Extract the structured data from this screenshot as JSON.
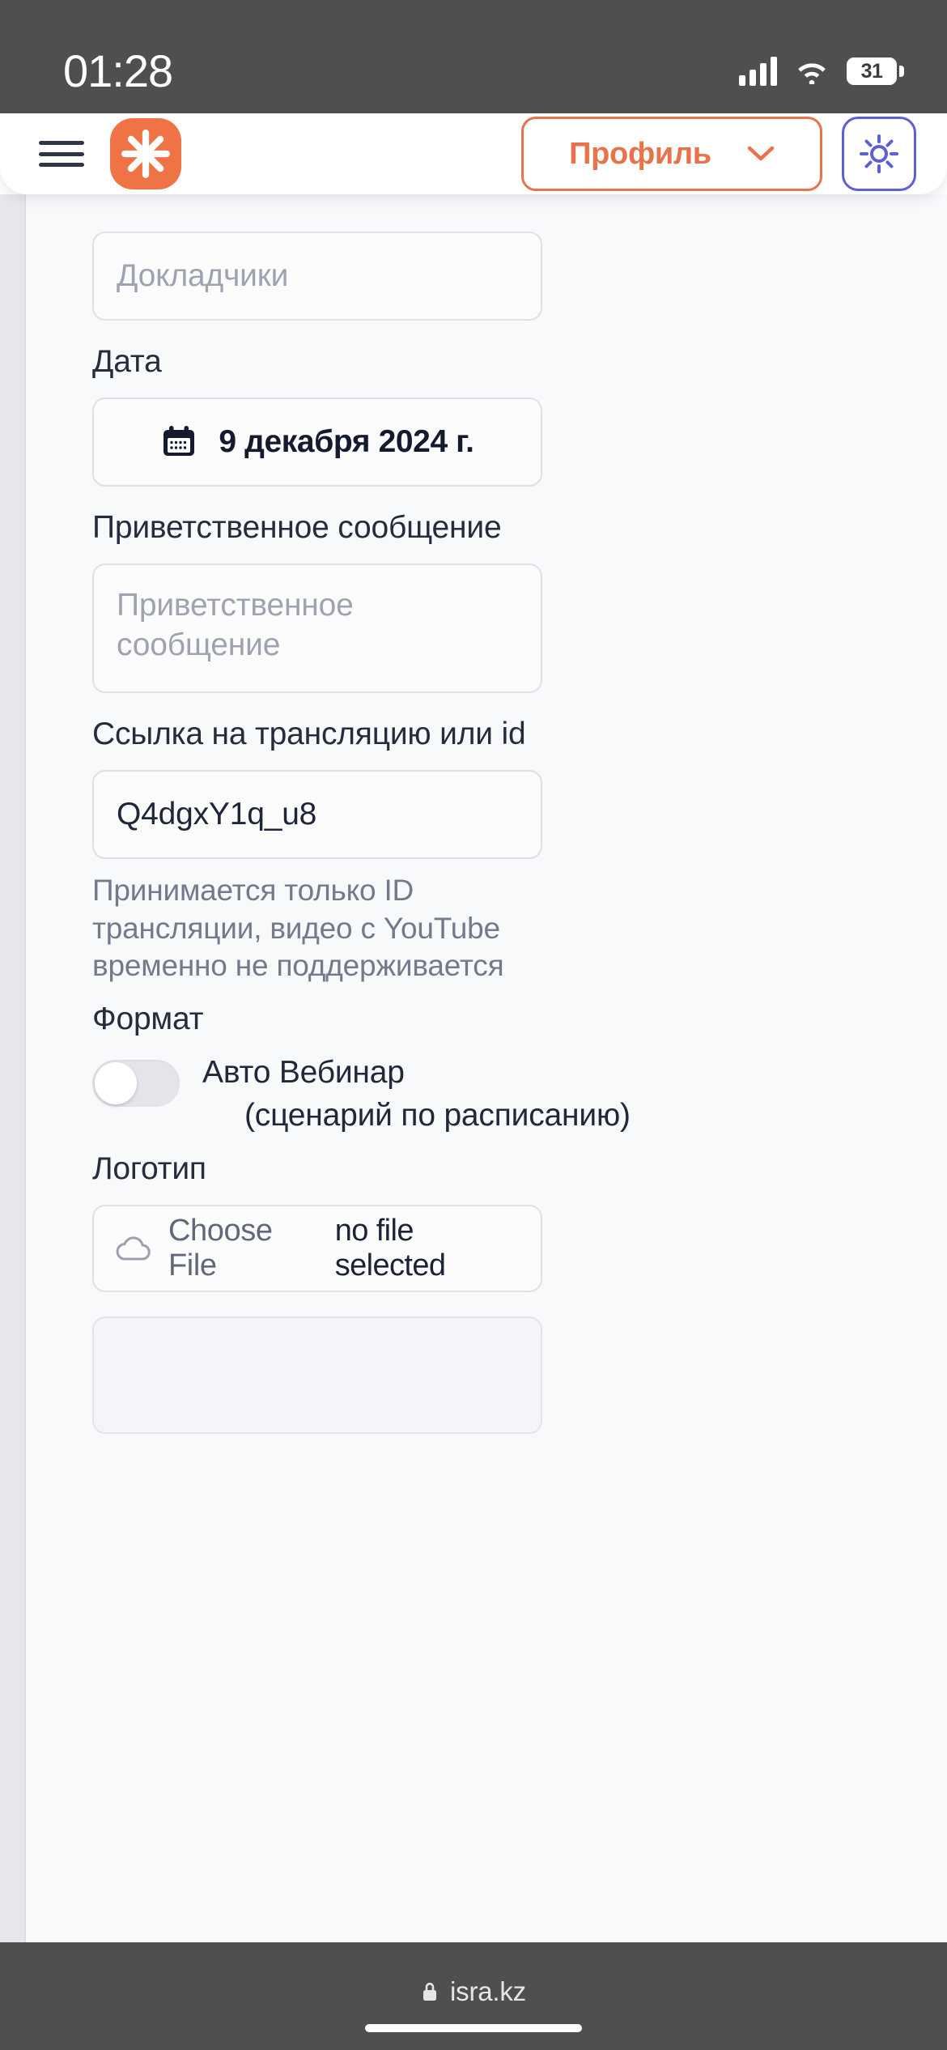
{
  "status_bar": {
    "time": "01:28",
    "battery_level": "31",
    "signal_icon": "cellular-bars-icon",
    "wifi_icon": "wifi-icon",
    "battery_icon": "battery-icon"
  },
  "header": {
    "menu_icon": "hamburger-menu-icon",
    "logo_icon": "asterisk-logo-icon",
    "logo_color": "#ef7344",
    "profile_label": "Профиль",
    "profile_chevron_icon": "chevron-down-icon",
    "profile_accent": "#e8734a",
    "theme_icon": "sun-icon",
    "theme_accent": "#5d5fd6"
  },
  "form": {
    "speakers": {
      "placeholder": "Докладчики",
      "value": ""
    },
    "date": {
      "label": "Дата",
      "icon": "calendar-icon",
      "value": "9 декабря 2024 г."
    },
    "greeting": {
      "label": "Приветственное сообщение",
      "placeholder": "Приветственное сообщение",
      "value": ""
    },
    "stream": {
      "label": "Ссылка на трансляцию или id",
      "value": "Q4dgxY1q_u8",
      "hint": "Принимается только ID трансляции, видео с YouTube временно не поддерживается"
    },
    "format": {
      "label": "Формат",
      "toggle_state": "off",
      "toggle_label_line1": "Авто Вебинар",
      "toggle_label_line2": "(сценарий по расписанию)"
    },
    "logo": {
      "label": "Логотип",
      "icon": "cloud-upload-icon",
      "choose_label": "Choose File",
      "file_status": "no file selected"
    }
  },
  "browser_bar": {
    "lock_icon": "lock-icon",
    "url": "isra.kz"
  }
}
